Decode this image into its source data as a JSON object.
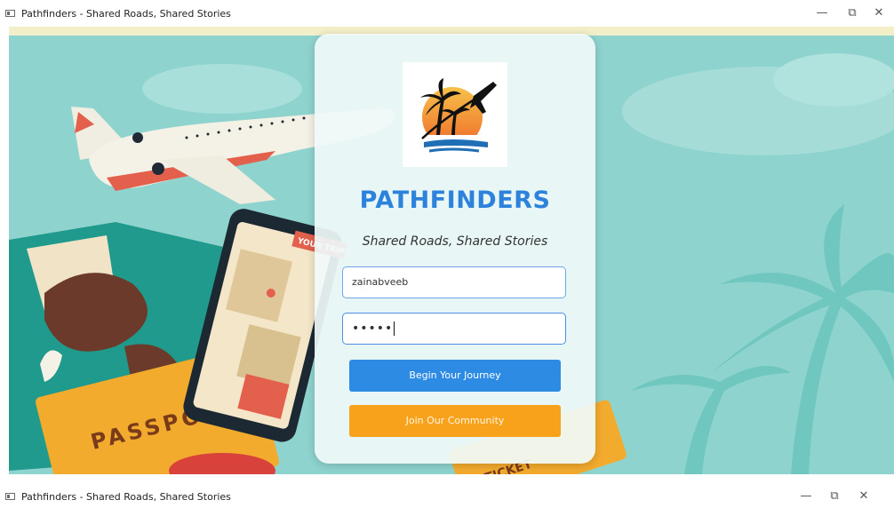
{
  "window": {
    "title": "Pathfinders - Shared Roads, Shared Stories",
    "minimize_glyph": "—",
    "maximize_glyph": "⧉",
    "close_glyph": "✕"
  },
  "background": {
    "passport_text": "PASSPORT",
    "phone_badge_text": "YOUR TRIP",
    "ticket_text": "TICKET"
  },
  "card": {
    "brand": "PATHFINDERS",
    "tagline": "Shared Roads, Shared Stories",
    "username_value": "zainabveeb",
    "password_mask": "•••••",
    "primary_button": "Begin Your Journey",
    "secondary_button": "Join Our Community"
  },
  "colors": {
    "brand_blue": "#2d82db",
    "primary_button": "#2d8be3",
    "secondary_button": "#f8a21b",
    "scene_teal": "#8fd3cf"
  }
}
